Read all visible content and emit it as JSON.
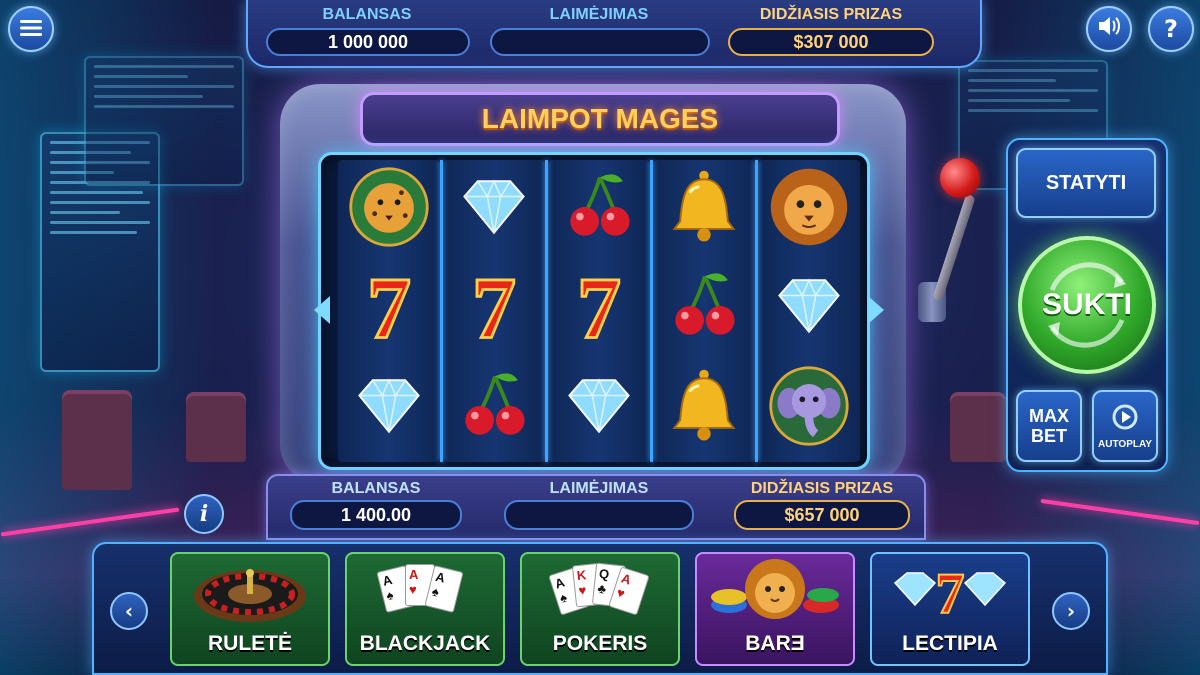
{
  "top_bar": {
    "balance_label": "BALANSAS",
    "balance_value": "1 000 000",
    "win_label": "LAIMĖJIMAS",
    "win_value": "",
    "jackpot_label": "DIDŽIASIS PRIZAS",
    "jackpot_value": "$307 000"
  },
  "machine": {
    "title": "LAIMPOT MAGES",
    "reels": [
      [
        "jaguar",
        "seven",
        "diamond"
      ],
      [
        "diamond",
        "seven",
        "cherry"
      ],
      [
        "cherry",
        "seven",
        "diamond"
      ],
      [
        "bell",
        "cherry",
        "bell"
      ],
      [
        "lion",
        "diamond",
        "elephant"
      ]
    ]
  },
  "controls": {
    "bet_label": "STATYTI",
    "spin_label": "SUKTI",
    "max_bet_label": "MAX\nBET",
    "autoplay_label": "AUTOPLAY"
  },
  "lower_bar": {
    "balance_label": "BALANSAS",
    "balance_value": "1 400.00",
    "win_label": "LAIMĖJIMAS",
    "win_value": "",
    "jackpot_label": "DIDŽIASIS PRIZAS",
    "jackpot_value": "$657 000"
  },
  "games": [
    {
      "label": "RULETĖ",
      "icon": "roulette-wheel-icon"
    },
    {
      "label": "BLACKJACK",
      "icon": "playing-cards-icon"
    },
    {
      "label": "POKERIS",
      "icon": "poker-hand-icon"
    },
    {
      "label": "BARƎ",
      "icon": "lion-chips-icon"
    },
    {
      "label": "LECTIPIA",
      "icon": "seven-diamonds-icon"
    }
  ],
  "colors": {
    "accent_blue": "#4fb4ff",
    "gold": "#ffd27a",
    "spin_green": "#2fa82a",
    "title_orange": "#ffcf5a"
  }
}
